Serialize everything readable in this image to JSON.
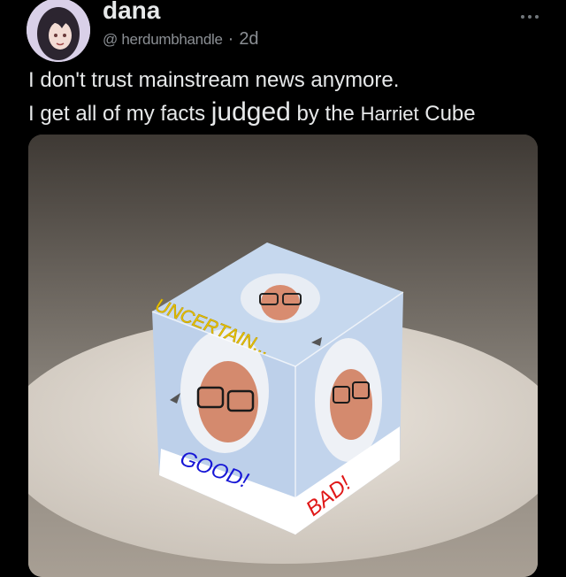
{
  "author": {
    "display_name": "dana",
    "handle": "@ herdumbhandle",
    "separator": "·",
    "time_ago": "2d"
  },
  "more_icon": "more-horizontal-icon",
  "tweet": {
    "line1": "I don't trust mainstream news anymore.",
    "line2_parts": [
      "I get all of my facts ",
      "judged",
      " by the ",
      "Harriet",
      " Cube"
    ]
  },
  "media": {
    "cube_labels": {
      "top_left_band": "UNCERTAIN...",
      "left_bottom": "GOOD!",
      "right_bottom": "BAD!"
    },
    "colors": {
      "uncertain": "#e9c400",
      "good": "#1616d6",
      "bad": "#e01818"
    }
  }
}
